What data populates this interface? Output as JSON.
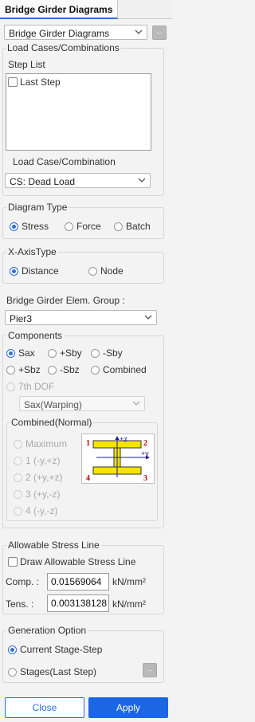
{
  "tab": {
    "title": "Bridge Girder Diagrams"
  },
  "top_select": {
    "value": "Bridge Girder Diagrams",
    "button": "..."
  },
  "load_cases": {
    "group_title": "Load Cases/Combinations",
    "step_list_label": "Step List",
    "step_items": [
      "Last Step"
    ],
    "load_case_label": "Load Case/Combination",
    "load_case_value": "CS: Dead Load"
  },
  "diagram_type": {
    "title": "Diagram Type",
    "options": [
      "Stress",
      "Force",
      "Batch"
    ],
    "selected": "Stress"
  },
  "x_axis_type": {
    "title": "X-AxisType",
    "options": [
      "Distance",
      "Node"
    ],
    "selected": "Distance"
  },
  "elem_group": {
    "label": "Bridge Girder Elem. Group :",
    "value": "Pier3"
  },
  "components": {
    "title": "Components",
    "row1": [
      "Sax",
      "+Sby",
      "-Sby"
    ],
    "row2": [
      "+Sbz",
      "-Sbz",
      "Combined"
    ],
    "selected": "Sax",
    "seventh_dof_label": "7th DOF",
    "warping_value": "Sax(Warping)"
  },
  "combined_normal": {
    "title": "Combined(Normal)",
    "options": [
      "Maximum",
      "1 (-y,+z)",
      "2 (+y,+z)",
      "3 (+y,-z)",
      "4 (-y,-z)"
    ],
    "diagram": {
      "corner_labels": [
        "1",
        "2",
        "3",
        "4"
      ],
      "axis_z": "+z",
      "axis_y": "+y",
      "beam_color": "#f4e400",
      "corner_color": "#c00000",
      "axis_color": "#1a1aa0"
    }
  },
  "allowable_stress": {
    "title": "Allowable Stress Line",
    "draw_label": "Draw Allowable Stress Line",
    "comp_label": "Comp. :",
    "comp_value": "0.01569064",
    "tens_label": "Tens. :",
    "tens_value": "0.003138128",
    "unit": "kN/mm²"
  },
  "generation_option": {
    "title": "Generation Option",
    "options": [
      "Current Stage-Step",
      "Stages(Last Step)"
    ],
    "selected": "Current Stage-Step",
    "button": "..."
  },
  "footer": {
    "close": "Close",
    "apply": "Apply"
  },
  "colors": {
    "accent": "#2d6fd6",
    "apply_bg": "#1a66e3"
  }
}
